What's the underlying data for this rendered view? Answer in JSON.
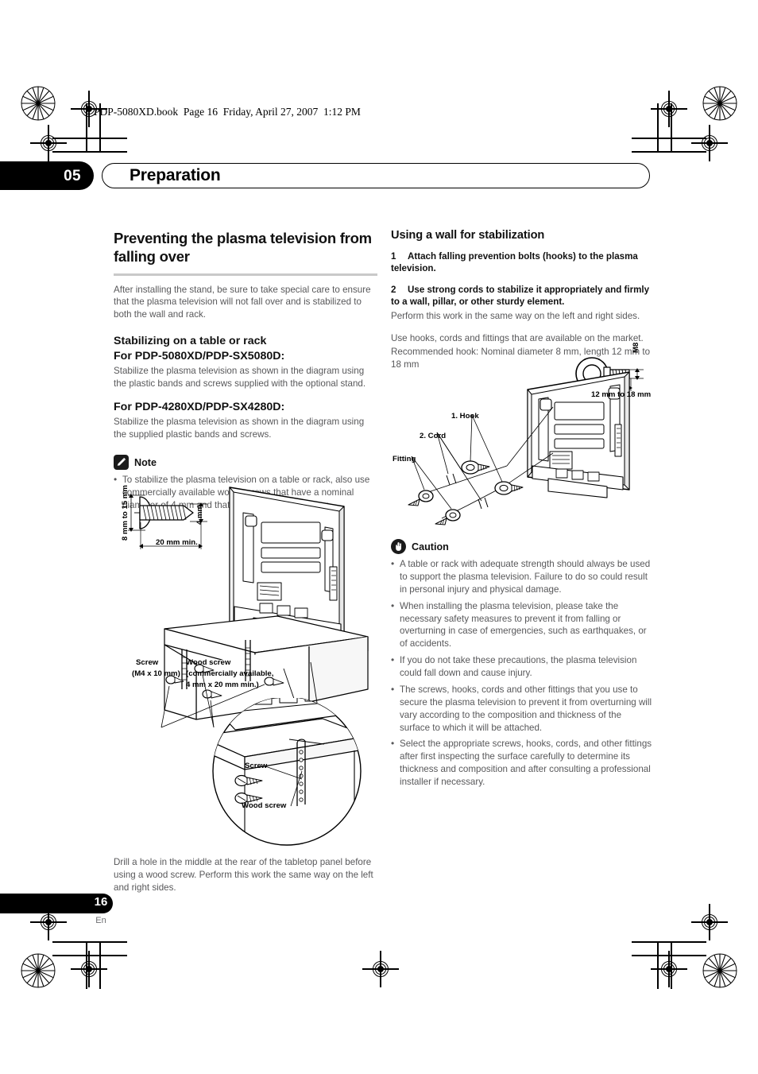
{
  "print_marks": {
    "note": "offset printing registration crosshairs and crop lines"
  },
  "header": {
    "book_line": "PDP-5080XD.book  Page 16  Friday, April 27, 2007  1:12 PM",
    "chapter_number": "05",
    "chapter_title": "Preparation"
  },
  "left_column": {
    "heading": "Preventing the plasma television from falling over",
    "intro": "After installing the stand, be sure to take special care to ensure that the plasma television will not fall over and is stabilized to both the wall and rack.",
    "subheading": "Stabilizing on a table or rack",
    "model_a_heading": "For PDP-5080XD/PDP-SX5080D:",
    "model_a_body": "Stabilize the plasma television as shown in the diagram using the plastic bands and screws supplied with the optional stand.",
    "model_b_heading": "For PDP-4280XD/PDP-SX4280D:",
    "model_b_body": "Stabilize the plasma television as shown in the diagram using the supplied plastic bands and screws.",
    "note": {
      "icon": "note-pencil-icon",
      "title": "Note",
      "items": [
        "To stabilize the plasma television on a table or rack, also use commercially available wood screws that have a nominal diameter of 4 mm and that are at least 20 mm long."
      ]
    },
    "figure_table": {
      "name": "table-rack-stabilization-diagram",
      "screw_dim_head": "8 mm to 15 mm",
      "screw_dim_tip": "4 mm",
      "screw_dim_length": "20 mm min.",
      "label_screw": "Screw",
      "label_screw_spec": "(M4 x 10 mm)",
      "label_wood_screw": "Wood screw",
      "label_wood_screw_spec1": "(commercially available,",
      "label_wood_screw_spec2": "4 mm x 20 mm min.)"
    },
    "figure_detail": {
      "name": "tabletop-panel-detail-inset",
      "label_screw": "Screw",
      "label_wood_screw": "Wood screw"
    },
    "caption": "Drill a hole in the middle at the rear of the tabletop panel before using a wood screw. Perform this work the same way on the left and right sides."
  },
  "right_column": {
    "heading": "Using a wall for stabilization",
    "steps": [
      {
        "number": "1",
        "text": "Attach falling prevention bolts (hooks) to the plasma television."
      },
      {
        "number": "2",
        "text": "Use strong cords to stabilize it appropriately and firmly to a wall, pillar, or other sturdy element."
      }
    ],
    "step2_note": "Perform this work in the same way on the left and right sides.",
    "hook_note_line1": "Use hooks, cords and fittings that are available on the market.",
    "hook_note_line2": "Recommended hook: Nominal diameter 8 mm, length 12 mm to 18 mm",
    "figure_wall": {
      "name": "wall-stabilization-diagram",
      "label_hook": "1. Hook",
      "label_cord": "2. Cord",
      "label_fitting": "Fitting",
      "bolt_thread": "M8",
      "bolt_length": "12 mm to 18 mm"
    },
    "caution": {
      "icon": "caution-hand-icon",
      "title": "Caution",
      "items": [
        "A table or rack with adequate strength should always be used to support the plasma television. Failure to do so could result in personal injury and physical damage.",
        "When installing the plasma television, please take the necessary safety measures to prevent it from falling or overturning in case of emergencies, such as earthquakes, or of accidents.",
        "If you do not take these precautions, the plasma television could fall down and cause injury.",
        "The screws, hooks, cords and other fittings that you use to secure the plasma television to prevent it from overturning will vary according to the composition and thickness of the surface to which it will be attached.",
        "Select the appropriate screws, hooks, cords, and other fittings after first inspecting the surface carefully to determine its thickness and composition and after consulting a professional installer if necessary."
      ]
    }
  },
  "footer": {
    "page_number": "16",
    "language": "En"
  }
}
